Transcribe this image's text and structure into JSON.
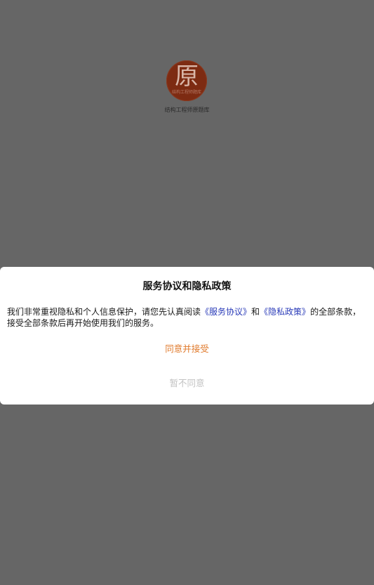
{
  "splash": {
    "logo_char": "原",
    "logo_subtitle": "结构工程师题库",
    "app_name": "结构工程师原题库",
    "logo_color": "#7d2b12"
  },
  "dialog": {
    "title": "服务协议和隐私政策",
    "body_part1": "我们非常重视隐私和个人信息保护，请您先认真阅读",
    "service_link": "《服务协议》",
    "body_and": "和",
    "privacy_link": "《隐私政策》",
    "body_part2": "的全部条款，接受全部条款后再开始使用我们的服务。",
    "agree_label": "同意并接受",
    "disagree_label": "暂不同意",
    "colors": {
      "link": "#2a3bb8",
      "agree": "#e07a2c",
      "disagree": "#c2c2c2",
      "overlay": "#666666"
    }
  }
}
